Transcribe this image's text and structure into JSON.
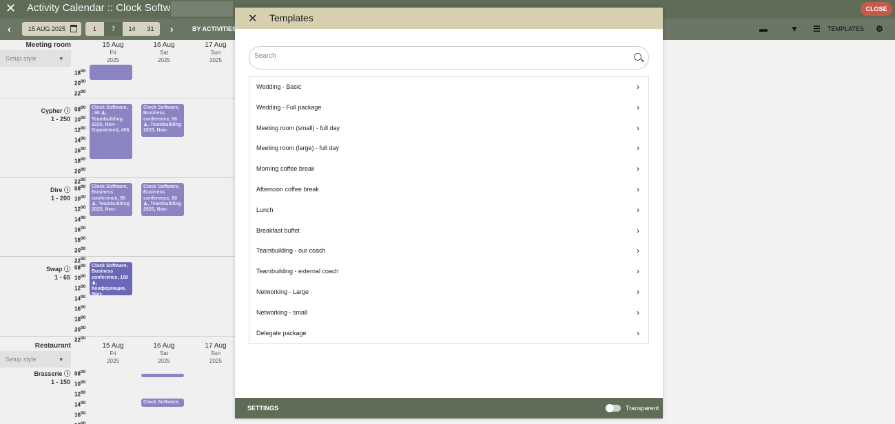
{
  "app": {
    "title": "Activity Calendar :: Clock Software,",
    "close_label": "CLOSE"
  },
  "toolbar": {
    "date": "15 AUG 2025",
    "views": [
      "1",
      "7",
      "14",
      "31"
    ],
    "active_view": "7",
    "by_activities": "BY ACTIVITIES",
    "templates_label": "TEMPLATES"
  },
  "calendar": {
    "days": [
      {
        "day": "15",
        "month": "Aug",
        "dow": "Fri",
        "year": "2025"
      },
      {
        "day": "16",
        "month": "Aug",
        "dow": "Sat",
        "year": "2025"
      },
      {
        "day": "17",
        "month": "Aug",
        "dow": "Sun",
        "year": "2025"
      }
    ],
    "sections": [
      {
        "title": "Meeting room",
        "setup_placeholder": "Setup style"
      },
      {
        "title": "Restaurant",
        "setup_placeholder": "Setup style"
      }
    ],
    "rooms": [
      {
        "name": "Cypher",
        "capacity": "1 - 250"
      },
      {
        "name": "Dire",
        "capacity": "1 - 200"
      },
      {
        "name": "Swap",
        "capacity": "1 - 65"
      },
      {
        "name": "Brasserie",
        "capacity": "1 - 150"
      }
    ],
    "events": [
      {
        "text": "Clock Software, , 90 ♟, Teambuilding 2025, Non-Guaranteed, #96"
      },
      {
        "text": "Clock Software, Business conference, 90 ♟, Teambuilding 2025, Non-"
      },
      {
        "text": "Clock Software, Business conference, 90 ♟, Teambuilding 2025, Non-"
      },
      {
        "text": "Clock Software, Business conference, 90 ♟, Teambuilding 2025, Non-"
      },
      {
        "text": "Clock Software, Business conference, 100 ♟, Конференция, Non-"
      },
      {
        "text": "Clock Software,"
      }
    ]
  },
  "modal": {
    "title": "Templates",
    "search_placeholder": "Search",
    "templates": [
      "Wedding - Basic",
      "Wedding - Full package",
      "Meeting room (small) - full day",
      "Meeting room (large) - full day",
      "Morning coffee break",
      "Afternoon coffee break",
      "Lunch",
      "Breakfast buffet",
      "Teambuilding - our coach",
      "Teambuilding - external coach",
      "Networking - Large",
      "Networking - small",
      "Delegate package"
    ],
    "settings_label": "SETTINGS",
    "transparent_label": "Transparent"
  }
}
